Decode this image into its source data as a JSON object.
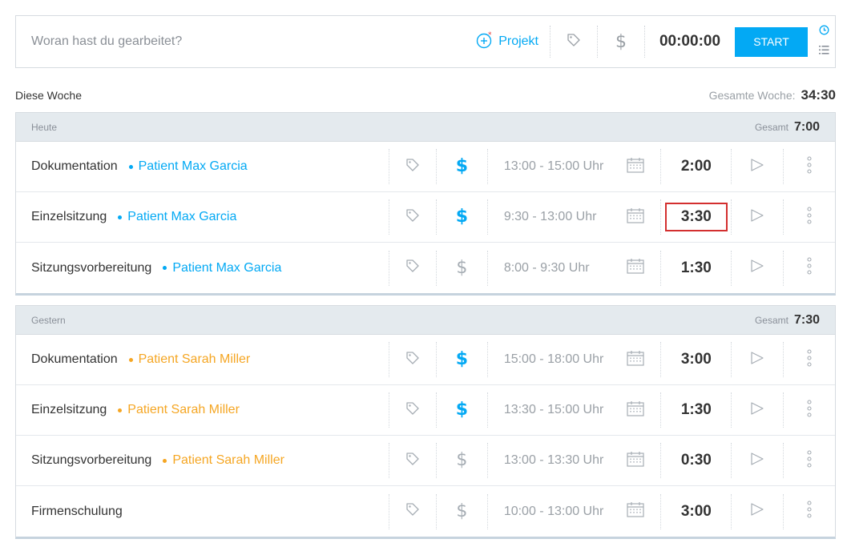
{
  "timer": {
    "description_placeholder": "Woran hast du gearbeitet?",
    "project_label": "Projekt",
    "time": "00:00:00",
    "start_label": "START"
  },
  "week": {
    "title": "Diese Woche",
    "total_label": "Gesamte Woche:",
    "total_value": "34:30"
  },
  "colors": {
    "accent": "#03a9f4",
    "project_blue": "#03a9f4",
    "project_orange": "#f5a623",
    "icon_gray": "#a6adb4",
    "highlight_border": "#d32f2f"
  },
  "days": [
    {
      "label": "Heute",
      "total_label": "Gesamt",
      "total_value": "7:00",
      "entries": [
        {
          "description": "Dokumentation",
          "project": "Patient Max Garcia",
          "project_color": "#03a9f4",
          "billable": true,
          "time_range": "13:00 - 15:00 Uhr",
          "duration": "2:00",
          "highlighted": false
        },
        {
          "description": "Einzelsitzung",
          "project": "Patient Max Garcia",
          "project_color": "#03a9f4",
          "billable": true,
          "time_range": "9:30 - 13:00 Uhr",
          "duration": "3:30",
          "highlighted": true
        },
        {
          "description": "Sitzungsvorbereitung",
          "project": "Patient Max Garcia",
          "project_color": "#03a9f4",
          "billable": false,
          "time_range": "8:00 - 9:30 Uhr",
          "duration": "1:30",
          "highlighted": false
        }
      ]
    },
    {
      "label": "Gestern",
      "total_label": "Gesamt",
      "total_value": "7:30",
      "entries": [
        {
          "description": "Dokumentation",
          "project": "Patient Sarah Miller",
          "project_color": "#f5a623",
          "billable": true,
          "time_range": "15:00 - 18:00 Uhr",
          "duration": "3:00",
          "highlighted": false
        },
        {
          "description": "Einzelsitzung",
          "project": "Patient Sarah Miller",
          "project_color": "#f5a623",
          "billable": true,
          "time_range": "13:30 - 15:00 Uhr",
          "duration": "1:30",
          "highlighted": false
        },
        {
          "description": "Sitzungsvorbereitung",
          "project": "Patient Sarah Miller",
          "project_color": "#f5a623",
          "billable": false,
          "time_range": "13:00 - 13:30 Uhr",
          "duration": "0:30",
          "highlighted": false
        },
        {
          "description": "Firmenschulung",
          "project": "",
          "project_color": "",
          "billable": false,
          "time_range": "10:00 - 13:00 Uhr",
          "duration": "3:00",
          "highlighted": false
        }
      ]
    }
  ]
}
